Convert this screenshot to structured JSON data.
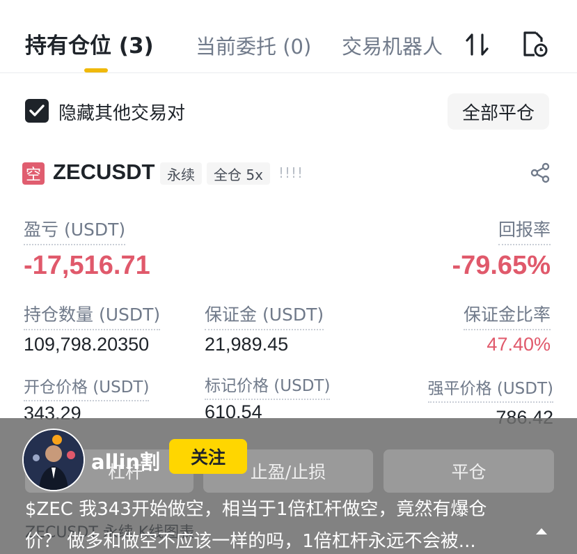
{
  "tabs": [
    {
      "label": "持有仓位 (3)"
    },
    {
      "label": "当前委托 (0)"
    },
    {
      "label": "交易机器人"
    }
  ],
  "filter": {
    "hide_others_label": "隐藏其他交易对",
    "hide_others_checked": true,
    "close_all_label": "全部平仓"
  },
  "position": {
    "side_badge": "空",
    "symbol": "ZECUSDT",
    "contract_type": "永续",
    "margin_mode": "全仓 5x",
    "bars": "!!!!",
    "pnl_label": "盈亏 (USDT)",
    "pnl_value": "-17,516.71",
    "roe_label": "回报率",
    "roe_value": "-79.65%",
    "size_label": "持仓数量 (USDT)",
    "size_value": "109,798.20350",
    "margin_label": "保证金 (USDT)",
    "margin_value": "21,989.45",
    "margin_ratio_label": "保证金比率",
    "margin_ratio_value": "47.40%",
    "entry_label": "开仓价格 (USDT)",
    "entry_value": "343.29",
    "mark_label": "标记价格 (USDT)",
    "mark_value": "610.54",
    "liq_label": "强平价格 (USDT)",
    "liq_value": "786.42"
  },
  "actions": {
    "leverage": "杠杆",
    "tpsl": "止盈/止损",
    "close": "平仓"
  },
  "next_row_peek": "ZECUSDT 永续 K线图表",
  "post": {
    "author": "allin割",
    "follow_label": "关注",
    "caption_line1": "$ZEC   我343开始做空，相当于1倍杠杆做空，竟然有爆仓",
    "caption_line2": "价？  做多和做空不应该一样的吗，1倍杠杆永远不会被..."
  },
  "colors": {
    "accent": "#f0b90b",
    "negative": "#e0596b",
    "follow": "#ffd600"
  }
}
